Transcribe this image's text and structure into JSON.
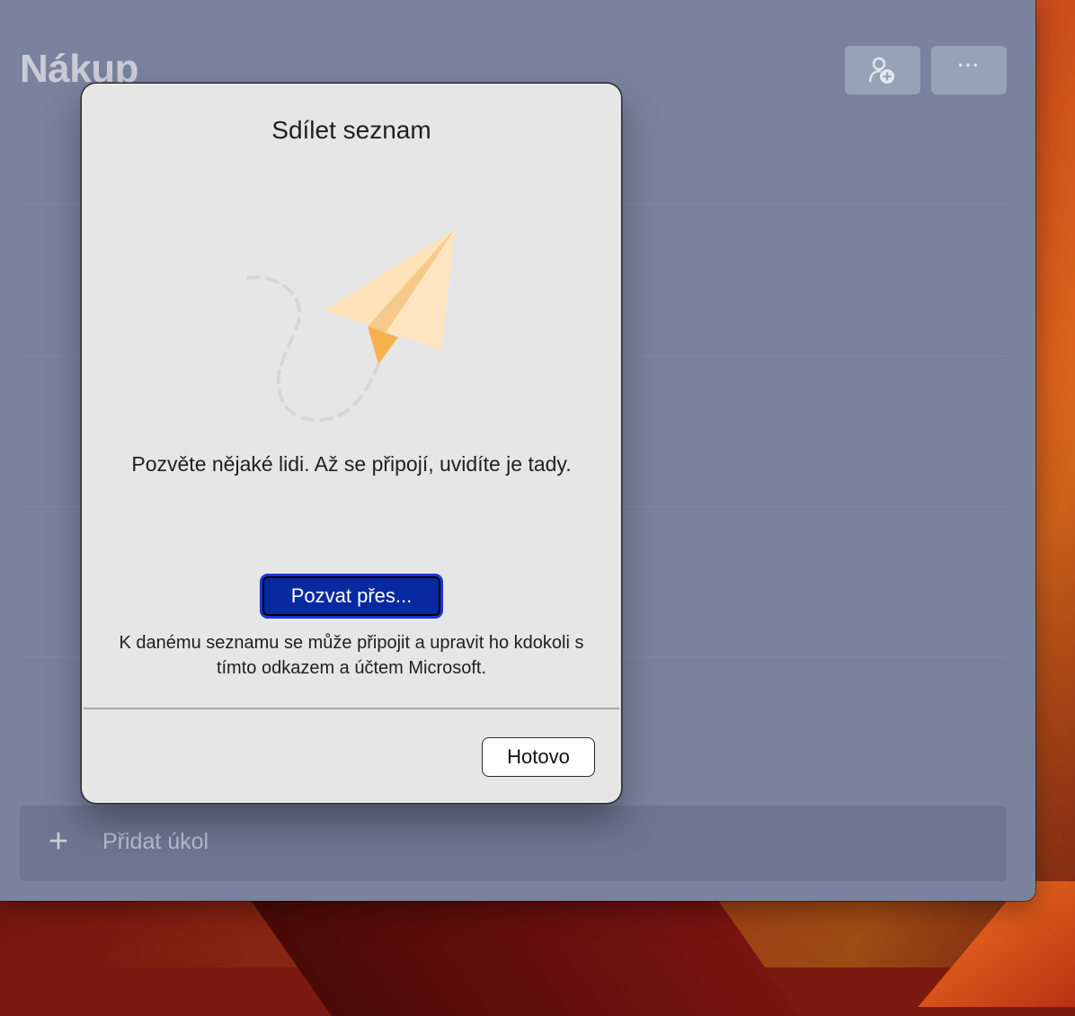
{
  "app": {
    "list_title": "Nákup",
    "header_buttons": {
      "share_icon": "person-add-icon",
      "more_label": "···"
    },
    "add_task": {
      "icon": "plus-icon",
      "placeholder": "Přidat úkol"
    }
  },
  "dialog": {
    "title": "Sdílet seznam",
    "illustration": "paper-plane-icon",
    "message": "Pozvěte nějaké lidi. Až se připojí, uvidíte je tady.",
    "invite_button": "Pozvat přes...",
    "note": "K danému seznamu se může připojit a upravit ho kdokoli s tímto odkazem a účtem Microsoft.",
    "done_button": "Hotovo"
  },
  "colors": {
    "window_background": "#7a829e",
    "dialog_background": "#e6e6e6",
    "primary_button": "#082aa0",
    "plane_light": "#ffe3b8",
    "plane_dark": "#f7b14c"
  }
}
